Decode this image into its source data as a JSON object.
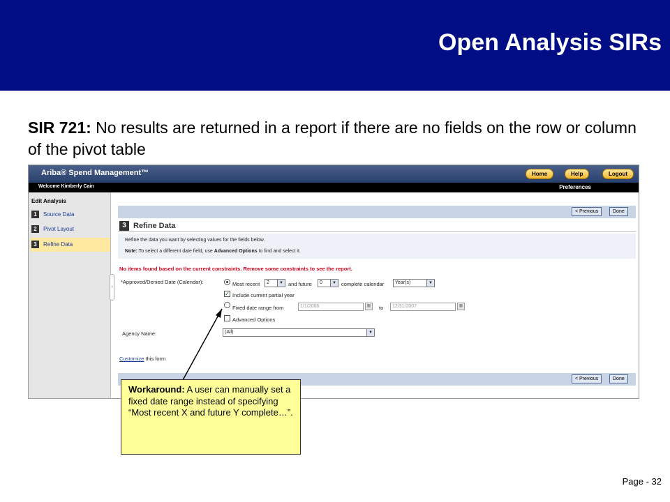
{
  "slide": {
    "title": "Open Analysis SIRs",
    "sir_label": "SIR 721:",
    "sir_text": " No results are returned in a report if there are no fields on the row or column of the pivot table",
    "page_number": "Page - 32",
    "callout_label": "Workaround:",
    "callout_text": " A user can manually set a fixed date range instead of specifying “Most recent X and future Y complete…”."
  },
  "app": {
    "logo": "Ariba® Spend Management™",
    "top_buttons": {
      "home": "Home",
      "help": "Help",
      "logout": "Logout"
    },
    "welcome": "Welcome Kimberly Cain",
    "preferences": "Preferences"
  },
  "sidebar": {
    "title": "Edit Analysis",
    "items": [
      {
        "num": "1",
        "label": "Source Data"
      },
      {
        "num": "2",
        "label": "Pivot Layout"
      },
      {
        "num": "3",
        "label": "Refine Data"
      }
    ]
  },
  "main": {
    "previous": "< Previous",
    "done": "Done",
    "section_num": "3",
    "section_title": "Refine Data",
    "info_line1": "Refine the data you want by selecting values for the fields below.",
    "note_label": "Note:",
    "note_pre": " To select a different date field, use ",
    "note_bold": "Advanced Options",
    "note_post": " to find and select it.",
    "warning": "No items found based on the current constraints. Remove some constraints to see the report.",
    "date_field_label": "*Approved/Denied Date (Calendar):",
    "most_recent": "Most recent",
    "most_recent_value": "2",
    "and_future": "and future",
    "future_value": "0",
    "complete_calendar": "complete calendar",
    "period_value": "Year(s)",
    "include_partial": "Include current partial year",
    "fixed_range": "Fixed date range from",
    "from_date": "1/1/2006",
    "to_label": "to",
    "to_date": "12/31/2007",
    "advanced_options": "Advanced Options",
    "agency_label": "Agency Name:",
    "agency_value": "(All)",
    "customize_link": "Customize",
    "customize_rest": " this form"
  }
}
